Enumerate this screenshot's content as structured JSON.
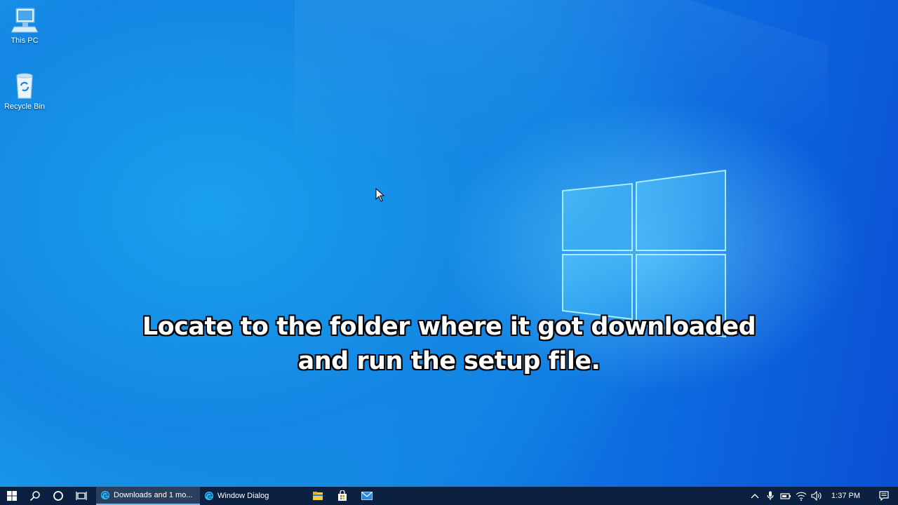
{
  "desktop": {
    "icons": [
      {
        "label": "This PC",
        "icon": "computer-icon"
      },
      {
        "label": "Recycle Bin",
        "icon": "recycle-bin-icon"
      }
    ],
    "caption": {
      "line1": "Locate to the folder where it got downloaded",
      "line2": "and run the setup file."
    }
  },
  "taskbar": {
    "start_icon": "windows-logo-icon",
    "search_icon": "search-icon",
    "cortana_icon": "cortana-circle-icon",
    "task_view_icon": "task-view-icon",
    "apps": [
      {
        "label": "Downloads and 1 mo...",
        "icon": "edge-icon",
        "active": true
      },
      {
        "label": "Window Dialog",
        "icon": "edge-icon",
        "active": false
      }
    ],
    "pinned": [
      "file-explorer-icon",
      "store-icon",
      "mail-icon"
    ],
    "tray": {
      "icons": [
        "chevron-up-icon",
        "microphone-icon",
        "battery-icon",
        "wifi-icon",
        "volume-icon"
      ],
      "time": "1:37 PM",
      "notification_icon": "notification-icon"
    }
  },
  "colors": {
    "taskbar_bg": "#0c2141",
    "active_app_bg": "#2a3f5e",
    "accent": "#76b9ed",
    "desktop_blue": "#1491e6"
  }
}
